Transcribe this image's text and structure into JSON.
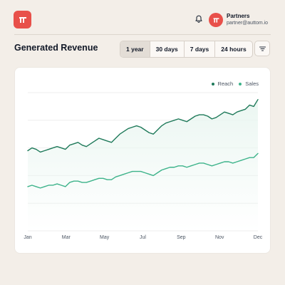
{
  "header": {
    "logo_icon": "app-logo-icon",
    "bell_icon": "bell-icon",
    "avatar_icon": "avatar-icon",
    "user_name": "Partners",
    "user_email": "partner@auttom.io"
  },
  "toolbar": {
    "title": "Generated Revenue",
    "ranges": [
      {
        "label": "1 year",
        "active": true
      },
      {
        "label": "30 days",
        "active": false
      },
      {
        "label": "7 days",
        "active": false
      },
      {
        "label": "24 hours",
        "active": false
      }
    ],
    "filter_icon": "filter-icon"
  },
  "colors": {
    "brand": "#e8504a",
    "reach": "#1f7a5a",
    "sales": "#3db38a",
    "area": "#eaf6f1"
  },
  "chart_data": {
    "type": "line",
    "title": "",
    "xlabel": "",
    "ylabel": "",
    "categories": [
      "Jan",
      "Mar",
      "May",
      "Jul",
      "Sep",
      "Nov",
      "Dec"
    ],
    "x": [
      0,
      1,
      2,
      3,
      4,
      5,
      6,
      7,
      8,
      9,
      10,
      11,
      12,
      13,
      14,
      15,
      16,
      17,
      18,
      19,
      20,
      21,
      22,
      23,
      24,
      25,
      26,
      27,
      28,
      29,
      30,
      31,
      32,
      33,
      34,
      35,
      36,
      37,
      38,
      39,
      40,
      41,
      42,
      43,
      44,
      45,
      46,
      47,
      48,
      49,
      50,
      51,
      52,
      53,
      54,
      55
    ],
    "ylim": [
      0,
      100
    ],
    "grid": true,
    "legend": "top-right",
    "series": [
      {
        "name": "Reach",
        "values": [
          58,
          60,
          59,
          57,
          58,
          59,
          60,
          61,
          60,
          59,
          62,
          63,
          64,
          62,
          61,
          63,
          65,
          67,
          66,
          65,
          64,
          67,
          70,
          72,
          74,
          75,
          76,
          75,
          73,
          71,
          70,
          73,
          76,
          78,
          79,
          80,
          81,
          80,
          79,
          81,
          83,
          84,
          84,
          83,
          81,
          82,
          84,
          86,
          85,
          84,
          86,
          87,
          88,
          91,
          90,
          95
        ]
      },
      {
        "name": "Sales",
        "values": [
          32,
          33,
          32,
          31,
          32,
          33,
          33,
          34,
          33,
          32,
          35,
          36,
          36,
          35,
          35,
          36,
          37,
          38,
          38,
          37,
          37,
          39,
          40,
          41,
          42,
          43,
          43,
          43,
          42,
          41,
          40,
          42,
          44,
          45,
          46,
          46,
          47,
          47,
          46,
          47,
          48,
          49,
          49,
          48,
          47,
          48,
          49,
          50,
          50,
          49,
          50,
          51,
          52,
          53,
          53,
          56
        ]
      }
    ]
  }
}
